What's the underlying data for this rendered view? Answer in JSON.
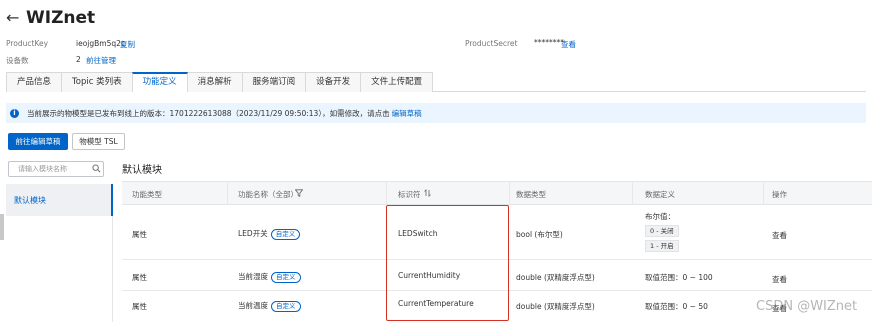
{
  "header": {
    "back_arrow": "←",
    "title": "WIZnet"
  },
  "meta": {
    "product_key_label": "ProductKey",
    "product_key_value": "ieojgBm5q2c",
    "copy_link": "复制",
    "device_count_label": "设备数",
    "device_count_value": "2",
    "manage_link": "前往管理",
    "product_secret_label": "ProductSecret",
    "product_secret_value": "********",
    "view_link": "查看"
  },
  "tabs": [
    {
      "label": "产品信息",
      "active": false
    },
    {
      "label": "Topic 类列表",
      "active": false
    },
    {
      "label": "功能定义",
      "active": true
    },
    {
      "label": "消息解析",
      "active": false
    },
    {
      "label": "服务端订阅",
      "active": false
    },
    {
      "label": "设备开发",
      "active": false
    },
    {
      "label": "文件上传配置",
      "active": false
    }
  ],
  "notice": {
    "icon": "info-icon",
    "text": "当前展示的物模型是已发布到线上的版本：1701222613088（2023/11/29 09:50:13），如需修改，请点击",
    "link": "编辑草稿"
  },
  "toolbar": {
    "edit_draft_label": "前往编辑草稿",
    "tsl_label": "物模型 TSL"
  },
  "module_panel": {
    "search_placeholder": "请输入模块名称",
    "search_icon": "search-icon",
    "items": [
      {
        "label": "默认模块",
        "active": true
      }
    ]
  },
  "main": {
    "module_title": "默认模块",
    "columns": {
      "type": "功能类型",
      "name": "功能名称（全部）",
      "identifier": "标识符",
      "data_type": "数据类型",
      "data_def": "数据定义",
      "ops": "操作"
    },
    "rows": [
      {
        "type": "属性",
        "name": "LED开关",
        "tag": "自定义",
        "identifier": "LEDSwitch",
        "data_type": "bool (布尔型)",
        "def_label": "布尔值：",
        "def_values": [
          "0 - 关闭",
          "1 - 开启"
        ],
        "op": "查看"
      },
      {
        "type": "属性",
        "name": "当前湿度",
        "tag": "自定义",
        "identifier": "CurrentHumidity",
        "data_type": "double (双精度浮点型)",
        "def_text": "取值范围：0 ~ 100",
        "op": "查看"
      },
      {
        "type": "属性",
        "name": "当前温度",
        "tag": "自定义",
        "identifier": "CurrentTemperature",
        "data_type": "double (双精度浮点型)",
        "def_text": "取值范围：0 ~ 50",
        "op": "查看"
      }
    ]
  },
  "watermark": "CSDN @WIZnet",
  "colors": {
    "accent": "#0064c8",
    "highlight_border": "#d93026",
    "notice_bg": "#ebf5ff"
  }
}
